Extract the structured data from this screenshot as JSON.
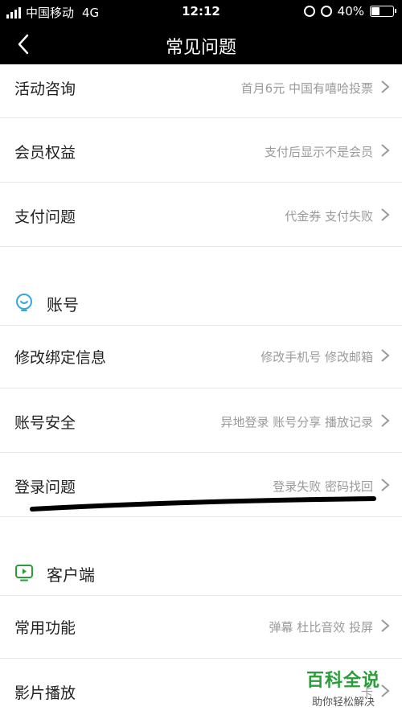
{
  "status_bar": {
    "carrier": "中国移动",
    "network": "4G",
    "time": "12:12",
    "battery": "40%",
    "battery_level": 0.4
  },
  "nav": {
    "title": "常见问题"
  },
  "rows_top": [
    {
      "label": "活动咨询",
      "hint": "首月6元 中国有嘻哈投票"
    },
    {
      "label": "会员权益",
      "hint": "支付后显示不是会员"
    },
    {
      "label": "支付问题",
      "hint": "代金券 支付失败"
    }
  ],
  "section_account": {
    "title": "账号",
    "icon": "lightbulb-icon",
    "rows": [
      {
        "label": "修改绑定信息",
        "hint": "修改手机号 修改邮箱"
      },
      {
        "label": "账号安全",
        "hint": "异地登录 账号分享 播放记录"
      },
      {
        "label": "登录问题",
        "hint": "登录失败 密码找回"
      }
    ]
  },
  "section_client": {
    "title": "客户端",
    "icon": "tv-play-icon",
    "rows": [
      {
        "label": "常用功能",
        "hint": "弹幕 杜比音效 投屏"
      },
      {
        "label": "影片播放",
        "hint": "卡"
      }
    ]
  },
  "watermark": {
    "title": "百科全说",
    "subtitle": "助你轻松解决"
  },
  "colors": {
    "accent_green": "#2a9d3a",
    "account_icon": "#36a9d8"
  }
}
